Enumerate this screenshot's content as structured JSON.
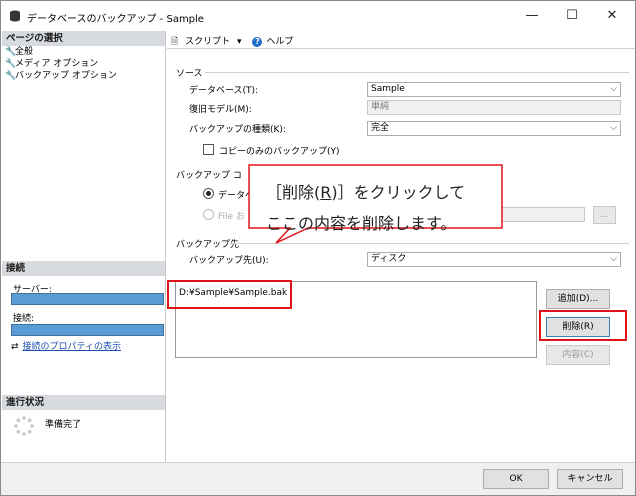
{
  "window": {
    "title": "データベースのバックアップ - Sample",
    "minimize": "—",
    "maximize": "☐",
    "close": "✕"
  },
  "left": {
    "page_select_header": "ページの選択",
    "pages": [
      "全般",
      "メディア オプション",
      "バックアップ オプション"
    ],
    "connection_header": "接続",
    "server_label": "サーバー:",
    "connection_label": "接続:",
    "conn_props_link": "接続のプロパティの表示",
    "progress_header": "進行状況",
    "status": "準備完了"
  },
  "toolbar": {
    "script": "スクリプト",
    "script_arrow": "▾",
    "help": "ヘルプ"
  },
  "source": {
    "group_label": "ソース",
    "database_label": "データベース(T):",
    "database_value": "Sample",
    "recovery_label": "復旧モデル(M):",
    "recovery_value": "単純",
    "backup_type_label": "バックアップの種類(K):",
    "backup_type_value": "完全",
    "copy_only_label": "コピーのみのバックアップ(Y)",
    "copy_only_checked": false
  },
  "component": {
    "group_label": "バックアップ コ",
    "database_radio": "データベ",
    "file_radio": "File お",
    "browse_btn": "..."
  },
  "destination": {
    "group_label": "バックアップ先",
    "dest_label": "バックアップ先(U):",
    "dest_value": "ディスク",
    "items": [
      "D:¥Sample¥Sample.bak"
    ],
    "add_btn": "追加(D)...",
    "remove_btn": "削除(R)",
    "contents_btn": "内容(C)"
  },
  "callout": {
    "line1_pre": "［削除(",
    "line1_key": "R",
    "line1_post": ")］をクリックして",
    "line2": "ここの内容を削除します。"
  },
  "buttons": {
    "ok": "OK",
    "cancel": "キャンセル"
  },
  "colors": {
    "highlight_red": "#e0131a",
    "conn_bar": "#5b9bd5",
    "section_header_bg": "#d7dbe0"
  }
}
